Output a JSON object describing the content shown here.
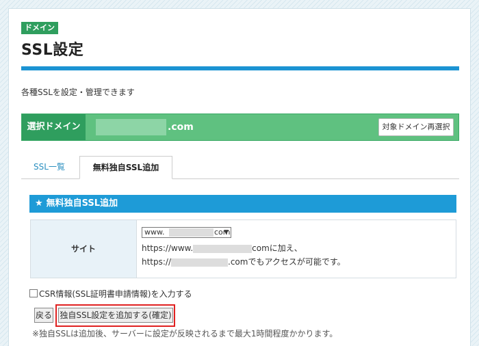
{
  "header": {
    "badge": "ドメイン",
    "title": "SSL設定",
    "description": "各種SSLを設定・管理できます"
  },
  "domain_bar": {
    "label": "選択ドメイン",
    "tld": ".com",
    "reselect_button": "対象ドメイン再選択"
  },
  "tabs": [
    {
      "label": "SSL一覧",
      "active": false
    },
    {
      "label": "無料独自SSL追加",
      "active": true
    }
  ],
  "section": {
    "star": "★",
    "title": "無料独自SSL追加"
  },
  "site_row": {
    "header": "サイト",
    "select_prefix": "www.",
    "select_suffix": "com",
    "select_arrow": "▼",
    "line2_prefix": "https://www.",
    "line2_suffix": "comに加え、",
    "line3_prefix": "https://",
    "line3_suffix": ".comでもアクセスが可能です。"
  },
  "csr_checkbox": {
    "label": "CSR情報(SSL証明書申請情報)を入力する",
    "checked": false
  },
  "buttons": {
    "back": "戻る",
    "add": "独自SSL設定を追加する(確定)"
  },
  "note": "※独自SSLは追加後、サーバーに設定が反映されるまで最大1時間程度かかります。",
  "colors": {
    "accent_blue": "#1b93d3",
    "green_dark": "#2f9e5e",
    "green_light": "#5fc180",
    "highlight_red": "#e02020"
  }
}
